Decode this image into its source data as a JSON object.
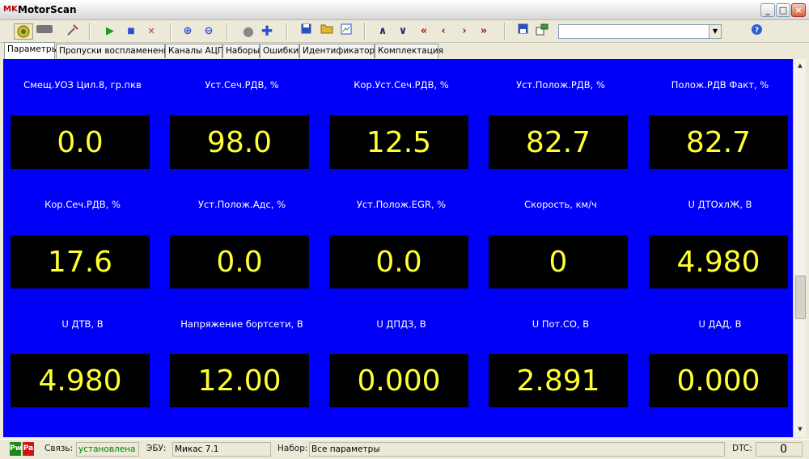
{
  "window": {
    "title": "MotorScan",
    "logo_text": "MK",
    "controls": [
      "minimize",
      "maximize",
      "close"
    ]
  },
  "toolbar": {
    "icons": [
      "connect-icon",
      "device-icon",
      "tools-icon",
      "play-icon",
      "stop-icon",
      "clear-icon",
      "zoom-in-icon",
      "zoom-out-icon",
      "record-icon",
      "add-icon",
      "save-icon",
      "open-icon",
      "export-icon",
      "up-icon",
      "down-icon",
      "first-icon",
      "prev-icon",
      "next-icon",
      "last-icon",
      "save-set-icon",
      "settings-icon",
      "help-icon"
    ],
    "combo_value": ""
  },
  "tabs": [
    {
      "label": "Параметры",
      "active": true
    },
    {
      "label": "Пропуски воспламенения",
      "active": false
    },
    {
      "label": "Каналы АЦП",
      "active": false
    },
    {
      "label": "Наборы",
      "active": false
    },
    {
      "label": "Ошибки",
      "active": false
    },
    {
      "label": "Идентификаторы",
      "active": false
    },
    {
      "label": "Комплектация",
      "active": false
    }
  ],
  "params": [
    {
      "label": "Смещ.УОЗ Цил.8, гр.пкв",
      "value": "0.0"
    },
    {
      "label": "Уст.Сеч.РДВ, %",
      "value": "98.0"
    },
    {
      "label": "Кор.Уст.Сеч.РДВ, %",
      "value": "12.5"
    },
    {
      "label": "Уст.Полож.РДВ, %",
      "value": "82.7"
    },
    {
      "label": "Полож.РДВ Факт, %",
      "value": "82.7"
    },
    {
      "label": "Кор.Сеч.РДВ, %",
      "value": "17.6"
    },
    {
      "label": "Уст.Полож.Адс, %",
      "value": "0.0"
    },
    {
      "label": "Уст.Полож.EGR, %",
      "value": "0.0"
    },
    {
      "label": "Скорость, км/ч",
      "value": "0"
    },
    {
      "label": "U ДТОхлЖ, В",
      "value": "4.980"
    },
    {
      "label": "U ДТВ, В",
      "value": "4.980"
    },
    {
      "label": "Напряжение бортсети, В",
      "value": "12.00"
    },
    {
      "label": "U ДПДЗ, В",
      "value": "0.000"
    },
    {
      "label": "U Пот.СО, В",
      "value": "2.891"
    },
    {
      "label": "U ДАД, В",
      "value": "0.000"
    }
  ],
  "status": {
    "link_label": "Связь:",
    "link_value": "установлена",
    "ecu_label": "ЭБУ:",
    "ecu_value": "Микас 7.1",
    "set_label": "Набор:",
    "set_value": "Все параметры",
    "dtc_label": "DTC:",
    "dtc_value": "0",
    "indicators": [
      "Pw",
      "Pa"
    ]
  },
  "colors": {
    "panel_bg": "#0000f8",
    "value_text": "#ffff33",
    "value_box": "#000000",
    "link_ok": "#008000"
  }
}
